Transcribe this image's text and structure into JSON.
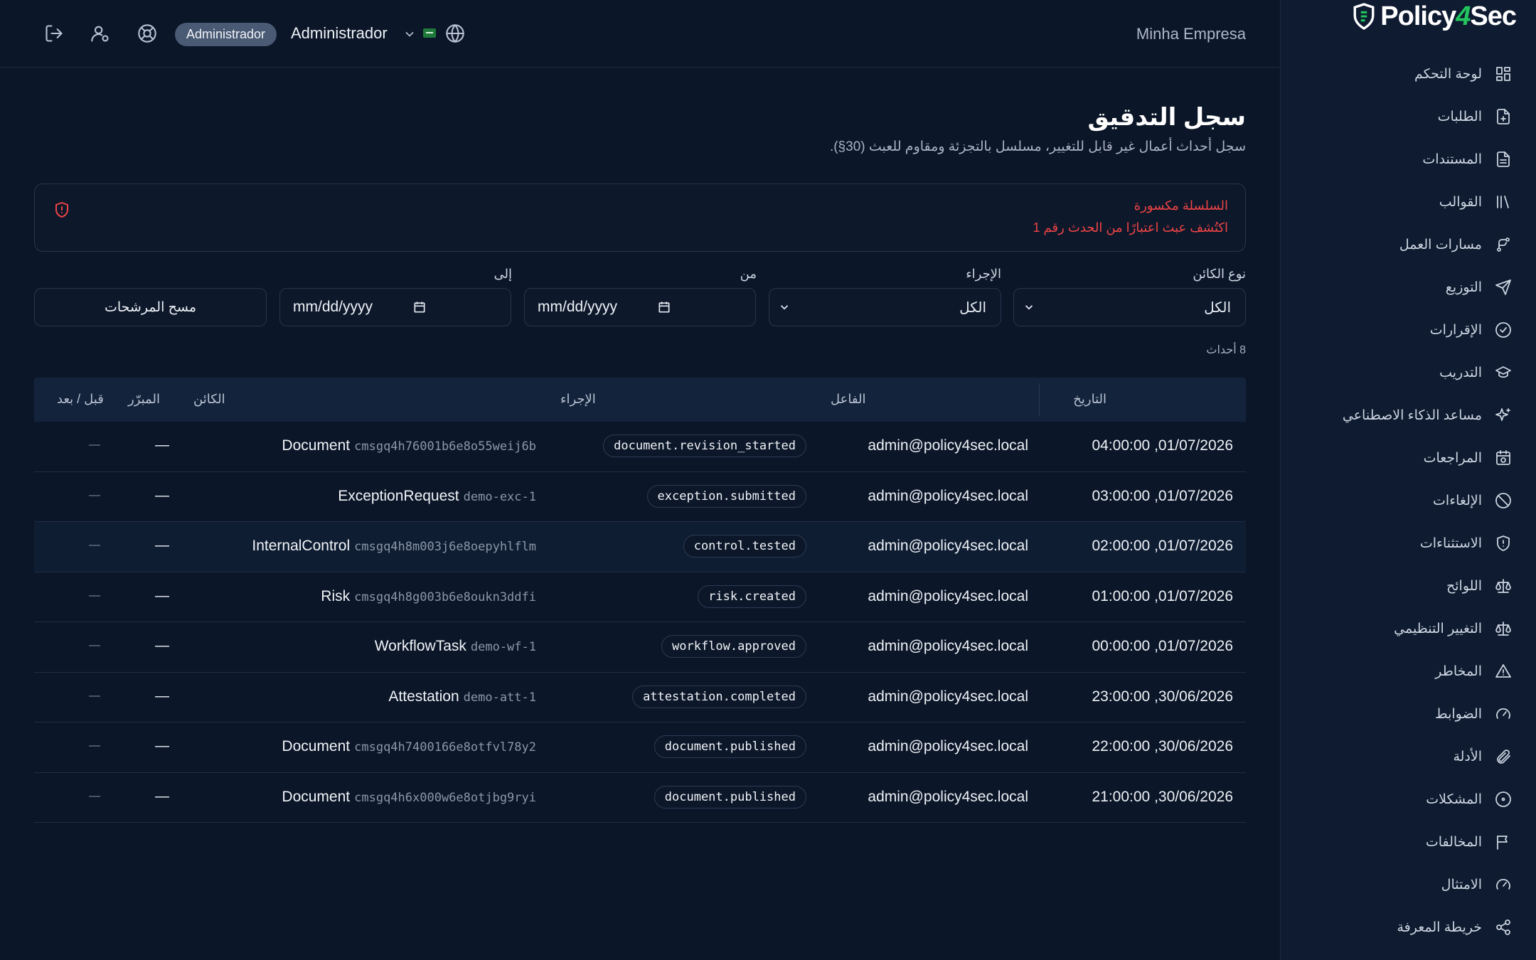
{
  "brand": {
    "name_part1": "Policy",
    "name_part2": "4",
    "name_part3": "Sec"
  },
  "header": {
    "role_badge": "Administrador",
    "user_name": "Administrador",
    "company": "Minha Empresa",
    "icons": [
      "logout-icon",
      "user-settings-icon",
      "help-icon",
      "globe-icon"
    ]
  },
  "sidebar": {
    "items": [
      {
        "label": "لوحة التحكم",
        "icon": "dashboard-icon"
      },
      {
        "label": "الطلبات",
        "icon": "file-plus-icon"
      },
      {
        "label": "المستندات",
        "icon": "document-icon"
      },
      {
        "label": "القوالب",
        "icon": "library-icon"
      },
      {
        "label": "مسارات العمل",
        "icon": "workflow-icon"
      },
      {
        "label": "التوزيع",
        "icon": "send-icon"
      },
      {
        "label": "الإقرارات",
        "icon": "check-circle-icon"
      },
      {
        "label": "التدريب",
        "icon": "graduation-cap-icon"
      },
      {
        "label": "مساعد الذكاء الاصطناعي",
        "icon": "sparkles-icon"
      },
      {
        "label": "المراجعات",
        "icon": "calendar-clock-icon"
      },
      {
        "label": "الإلغاءات",
        "icon": "ban-icon"
      },
      {
        "label": "الاستثناءات",
        "icon": "shield-icon"
      },
      {
        "label": "اللوائح",
        "icon": "scale-icon"
      },
      {
        "label": "التغيير التنظيمي",
        "icon": "scale-icon"
      },
      {
        "label": "المخاطر",
        "icon": "warning-icon"
      },
      {
        "label": "الضوابط",
        "icon": "gauge-icon"
      },
      {
        "label": "الأدلة",
        "icon": "paperclip-icon"
      },
      {
        "label": "المشكلات",
        "icon": "circle-dot-icon"
      },
      {
        "label": "المخالفات",
        "icon": "flag-icon"
      },
      {
        "label": "الامتثال",
        "icon": "gauge-icon"
      },
      {
        "label": "خريطة المعرفة",
        "icon": "share-icon"
      }
    ]
  },
  "page": {
    "title": "سجل التدقيق",
    "subtitle": "سجل أحداث أعمال غير قابل للتغيير، مسلسل بالتجزئة ومقاوم للعبث (30§)."
  },
  "alert": {
    "title": "السلسلة مكسورة",
    "message": "اكتُشف عبث اعتبارًا من الحدث رقم 1"
  },
  "filters": {
    "object_type_label": "نوع الكائن",
    "object_type_value": "الكل",
    "action_label": "الإجراء",
    "action_value": "الكل",
    "from_label": "من",
    "from_value": "mm/dd/yyyy",
    "to_label": "إلى",
    "to_value": "mm/dd/yyyy",
    "clear_button": "مسح المرشحات"
  },
  "count": "8 أحداث",
  "table": {
    "headers": {
      "date": "التاريخ",
      "actor": "الفاعل",
      "action": "الإجراء",
      "object": "الكائن",
      "reason": "المبرّر",
      "before_after": "قبل / بعد"
    },
    "rows": [
      {
        "date": "04:00:00 ,01/07/2026",
        "actor": "admin@policy4sec.local",
        "action": "document.revision_started",
        "obj_type": "Document",
        "obj_id": "cmsgq4h76001b6e8o55weij6b",
        "reason": "—",
        "before_after": "—"
      },
      {
        "date": "03:00:00 ,01/07/2026",
        "actor": "admin@policy4sec.local",
        "action": "exception.submitted",
        "obj_type": "ExceptionRequest",
        "obj_id": "demo-exc-1",
        "reason": "—",
        "before_after": "—"
      },
      {
        "date": "02:00:00 ,01/07/2026",
        "actor": "admin@policy4sec.local",
        "action": "control.tested",
        "obj_type": "InternalControl",
        "obj_id": "cmsgq4h8m003j6e8oepyhlflm",
        "reason": "—",
        "before_after": "—"
      },
      {
        "date": "01:00:00 ,01/07/2026",
        "actor": "admin@policy4sec.local",
        "action": "risk.created",
        "obj_type": "Risk",
        "obj_id": "cmsgq4h8g003b6e8oukn3ddfi",
        "reason": "—",
        "before_after": "—"
      },
      {
        "date": "00:00:00 ,01/07/2026",
        "actor": "admin@policy4sec.local",
        "action": "workflow.approved",
        "obj_type": "WorkflowTask",
        "obj_id": "demo-wf-1",
        "reason": "—",
        "before_after": "—"
      },
      {
        "date": "23:00:00 ,30/06/2026",
        "actor": "admin@policy4sec.local",
        "action": "attestation.completed",
        "obj_type": "Attestation",
        "obj_id": "demo-att-1",
        "reason": "—",
        "before_after": "—"
      },
      {
        "date": "22:00:00 ,30/06/2026",
        "actor": "admin@policy4sec.local",
        "action": "document.published",
        "obj_type": "Document",
        "obj_id": "cmsgq4h7400166e8otfvl78y2",
        "reason": "—",
        "before_after": "—"
      },
      {
        "date": "21:00:00 ,30/06/2026",
        "actor": "admin@policy4sec.local",
        "action": "document.published",
        "obj_type": "Document",
        "obj_id": "cmsgq4h6x000w6e8otjbg9ryi",
        "reason": "—",
        "before_after": "—"
      }
    ]
  }
}
